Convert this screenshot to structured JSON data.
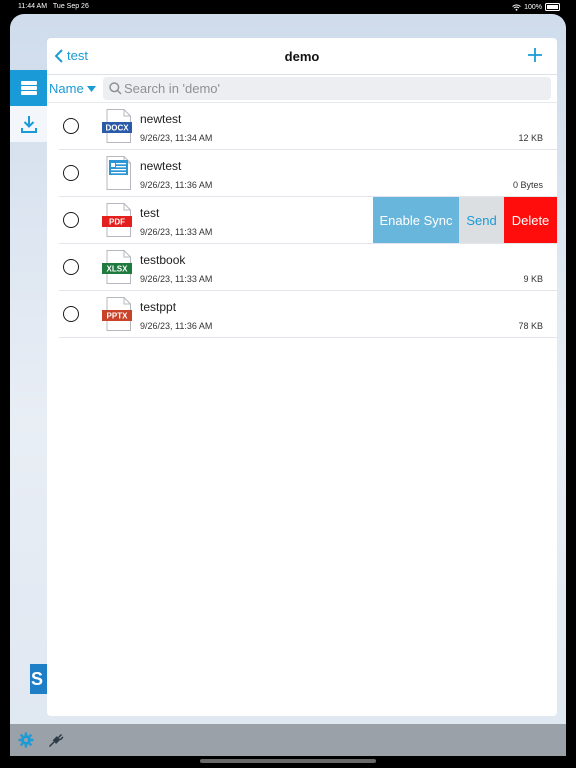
{
  "status_bar": {
    "time": "11:44 AM",
    "date": "Tue Sep 26",
    "battery": "100%"
  },
  "header": {
    "back_label": "test",
    "title": "demo"
  },
  "toolbar": {
    "sort_label": "Name",
    "search_placeholder": "Search in 'demo'"
  },
  "files": [
    {
      "name": "newtest",
      "date": "9/26/23, 11:34 AM",
      "size": "12 KB",
      "type": "DOCX",
      "badge_color": "#2a5aa8"
    },
    {
      "name": "newtest",
      "date": "9/26/23, 11:36 AM",
      "size": "0 Bytes",
      "type": "TXT",
      "badge_color": "#2b95d6"
    },
    {
      "name": "test",
      "date": "9/26/23, 11:33 AM",
      "size": "",
      "type": "PDF",
      "badge_color": "#e4201e"
    },
    {
      "name": "testbook",
      "date": "9/26/23, 11:33 AM",
      "size": "9 KB",
      "type": "XLSX",
      "badge_color": "#1f7a3d"
    },
    {
      "name": "testppt",
      "date": "9/26/23, 11:36 AM",
      "size": "78 KB",
      "type": "PPTX",
      "badge_color": "#c8432a"
    }
  ],
  "swipe_actions": {
    "enable_sync": "Enable Sync",
    "send": "Send",
    "delete": "Delete"
  },
  "colors": {
    "accent": "#1a9ad6",
    "delete": "#ff0d0d",
    "sync": "#69b6dd"
  },
  "icons": {
    "rail": [
      "storage-icon",
      "download-icon"
    ],
    "bottom": [
      "gear-icon",
      "plug-icon"
    ]
  }
}
